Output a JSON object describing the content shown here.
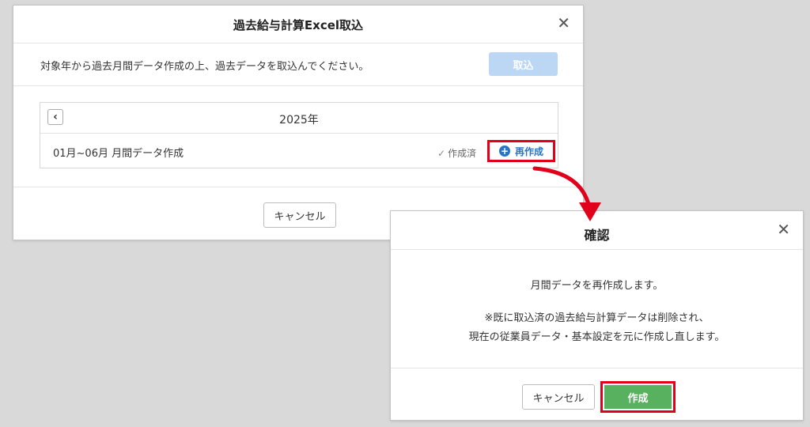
{
  "import_dialog": {
    "title": "過去給与計算Excel取込",
    "description": "対象年から過去月間データ作成の上、過去データを取込んでください。",
    "import_button": "取込",
    "year": "2025年",
    "prev_year_glyph": "‹",
    "row_label": "01月~06月 月間データ作成",
    "status_check": "✓",
    "status": "作成済",
    "recreate_button": "再作成",
    "cancel_button": "キャンセル",
    "close_glyph": "✕"
  },
  "confirm_dialog": {
    "title": "確認",
    "message": "月間データを再作成します。",
    "note_line1": "※既に取込済の過去給与計算データは削除され、",
    "note_line2": "現在の従業員データ・基本設定を元に作成し直します。",
    "cancel_button": "キャンセル",
    "create_button": "作成",
    "close_glyph": "✕"
  },
  "colors": {
    "highlight_border": "#e0001b",
    "primary_disabled": "#bcd7f3",
    "primary_link": "#2a74c4",
    "confirm_green": "#57b15e",
    "arrow": "#e0001b"
  },
  "icons": [
    "close-icon",
    "chevron-left-icon",
    "check-icon",
    "plus-circle-icon",
    "arrow-icon"
  ]
}
